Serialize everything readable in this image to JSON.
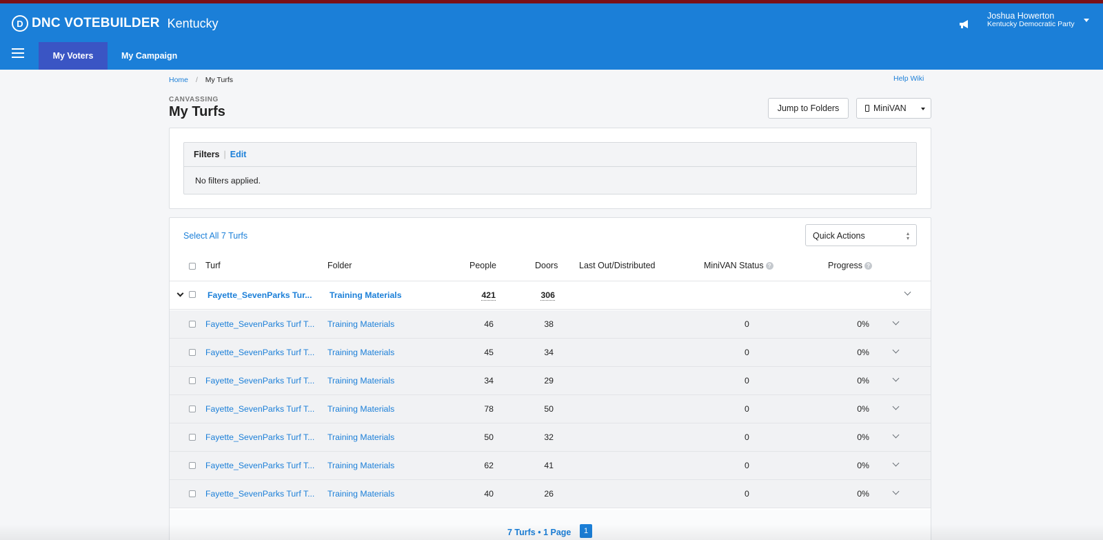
{
  "header": {
    "brand_mark": "D",
    "brand_name": "DNC VOTEBUILDER",
    "state": "Kentucky",
    "user_name": "Joshua Howerton",
    "user_org": "Kentucky Democratic Party",
    "accent_color": "#1b7fd8",
    "active_tab_color": "#3a55c4"
  },
  "nav": {
    "tab_my_voters": "My Voters",
    "tab_my_campaign": "My Campaign"
  },
  "breadcrumb": {
    "home": "Home",
    "separator": "/",
    "current": "My Turfs"
  },
  "help_link": "Help Wiki",
  "page": {
    "eyebrow": "CANVASSING",
    "title": "My Turfs"
  },
  "buttons": {
    "jump_to_folders": "Jump to Folders",
    "minivan": "MiniVAN"
  },
  "filters": {
    "label": "Filters",
    "separator": "|",
    "edit": "Edit",
    "body": "No filters applied."
  },
  "table": {
    "select_all": "Select All 7 Turfs",
    "quick_actions": "Quick Actions",
    "columns": {
      "turf": "Turf",
      "folder": "Folder",
      "people": "People",
      "doors": "Doors",
      "last_out": "Last Out/Distributed",
      "minivan_status": "MiniVAN Status",
      "progress": "Progress"
    },
    "help_mark": "?",
    "group": {
      "turf": "Fayette_SevenParks Tur...",
      "folder": "Training Materials",
      "people": "421",
      "doors": "306"
    },
    "rows": [
      {
        "turf": "Fayette_SevenParks Turf T...",
        "folder": "Training Materials",
        "people": "46",
        "doors": "38",
        "minivan_status": "0",
        "progress": "0%"
      },
      {
        "turf": "Fayette_SevenParks Turf T...",
        "folder": "Training Materials",
        "people": "45",
        "doors": "34",
        "minivan_status": "0",
        "progress": "0%"
      },
      {
        "turf": "Fayette_SevenParks Turf T...",
        "folder": "Training Materials",
        "people": "34",
        "doors": "29",
        "minivan_status": "0",
        "progress": "0%"
      },
      {
        "turf": "Fayette_SevenParks Turf T...",
        "folder": "Training Materials",
        "people": "78",
        "doors": "50",
        "minivan_status": "0",
        "progress": "0%"
      },
      {
        "turf": "Fayette_SevenParks Turf T...",
        "folder": "Training Materials",
        "people": "50",
        "doors": "32",
        "minivan_status": "0",
        "progress": "0%"
      },
      {
        "turf": "Fayette_SevenParks Turf T...",
        "folder": "Training Materials",
        "people": "62",
        "doors": "41",
        "minivan_status": "0",
        "progress": "0%"
      },
      {
        "turf": "Fayette_SevenParks Turf T...",
        "folder": "Training Materials",
        "people": "40",
        "doors": "26",
        "minivan_status": "0",
        "progress": "0%"
      }
    ]
  },
  "pager": {
    "summary": "7 Turfs • 1 Page",
    "current_page": "1"
  },
  "icons": {
    "logo": "dnc-d-logo-icon",
    "megaphone": "megaphone-icon",
    "menu": "hamburger-menu-icon",
    "phone": "phone-icon",
    "expand": "chevron-down-icon"
  }
}
